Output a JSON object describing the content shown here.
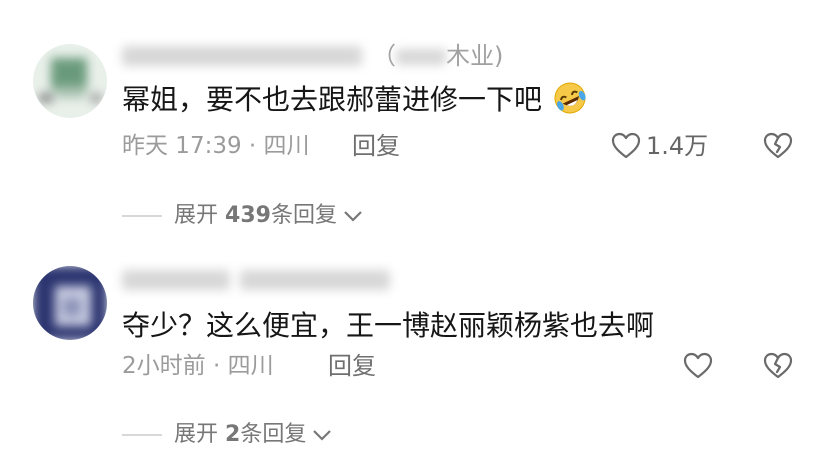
{
  "comments": [
    {
      "user_suffix": "（",
      "user_suffix_text": "木业)",
      "text": "幂姐，要不也去跟郝蕾进修一下吧",
      "meta": "昨天 17:39 · 四川",
      "reply_label": "回复",
      "like_count": "1.4万",
      "expand_prefix": "展开",
      "expand_count": "439",
      "expand_suffix": "条回复",
      "emoji": "rolling-laughing-emoji"
    },
    {
      "text": "夺少？这么便宜，王一博赵丽颖杨紫也去啊",
      "meta": "2小时前 · 四川",
      "reply_label": "回复",
      "like_count": "",
      "expand_prefix": "展开",
      "expand_count": "2",
      "expand_suffix": "条回复"
    }
  ],
  "colors": {
    "text": "#161616",
    "meta": "#9b9b9b",
    "icon": "#6a6a6a",
    "emoji_face": "#f7c948",
    "emoji_tear": "#4aa8e8"
  }
}
